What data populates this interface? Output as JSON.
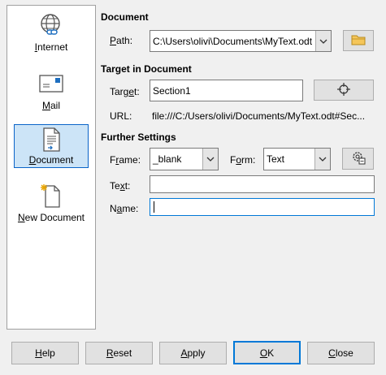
{
  "sidebar": {
    "items": [
      {
        "label_pre": "",
        "label_ul": "I",
        "label_post": "nternet",
        "icon": "globe-link-icon"
      },
      {
        "label_pre": "",
        "label_ul": "M",
        "label_post": "ail",
        "icon": "envelope-icon"
      },
      {
        "label_pre": "",
        "label_ul": "D",
        "label_post": "ocument",
        "icon": "document-icon"
      },
      {
        "label_pre": "",
        "label_ul": "N",
        "label_post": "ew Document",
        "icon": "new-document-icon"
      }
    ],
    "selected_index": 2
  },
  "document": {
    "header": "Document",
    "path_label_ul": "P",
    "path_label_post": "ath:",
    "path_value": "C:\\Users\\olivi\\Documents\\MyText.odt",
    "open_icon": "folder-icon"
  },
  "target": {
    "header": "Target in Document",
    "target_label_pre": "Targ",
    "target_label_ul": "e",
    "target_label_post": "t:",
    "target_value": "Section1",
    "target_button_icon": "crosshair-icon",
    "url_label": "URL:",
    "url_value": "file:///C:/Users/olivi/Documents/MyText.odt#Sec..."
  },
  "further": {
    "header": "Further Settings",
    "frame_label_pre": "F",
    "frame_label_ul": "r",
    "frame_label_post": "ame:",
    "frame_value": "_blank",
    "form_label_pre": "F",
    "form_label_ul": "o",
    "form_label_post": "rm:",
    "form_value": "Text",
    "events_icon": "gear-document-icon",
    "text_label_pre": "Te",
    "text_label_ul": "x",
    "text_label_post": "t:",
    "text_value": "",
    "name_label_pre": "N",
    "name_label_ul": "a",
    "name_label_post": "me:",
    "name_value": ""
  },
  "buttons": {
    "help": {
      "ul": "H",
      "post": "elp"
    },
    "reset": {
      "ul": "R",
      "post": "eset"
    },
    "apply": {
      "ul": "A",
      "post": "pply"
    },
    "ok": {
      "ul": "O",
      "post": "K"
    },
    "close": {
      "ul": "C",
      "post": "lose"
    }
  },
  "colors": {
    "selection": "#cce4f7",
    "selection_border": "#0a64c8",
    "focus_border": "#0078d7"
  }
}
